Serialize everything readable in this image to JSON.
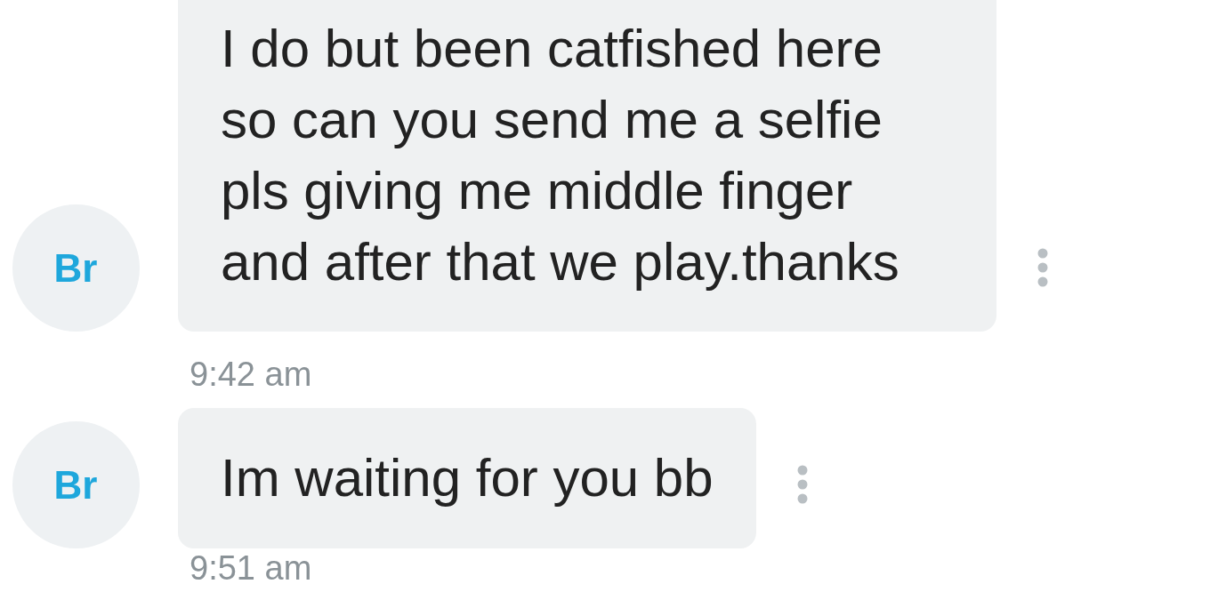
{
  "messages": [
    {
      "avatar": "Br",
      "lines": [
        "I do but been catfished here",
        "so can you send me a selfie",
        "pls giving me middle finger",
        "and after that we play.thanks"
      ],
      "time": "9:42 am"
    },
    {
      "avatar": "Br",
      "lines": [
        "Im waiting for you bb"
      ],
      "time": "9:51 am"
    }
  ]
}
